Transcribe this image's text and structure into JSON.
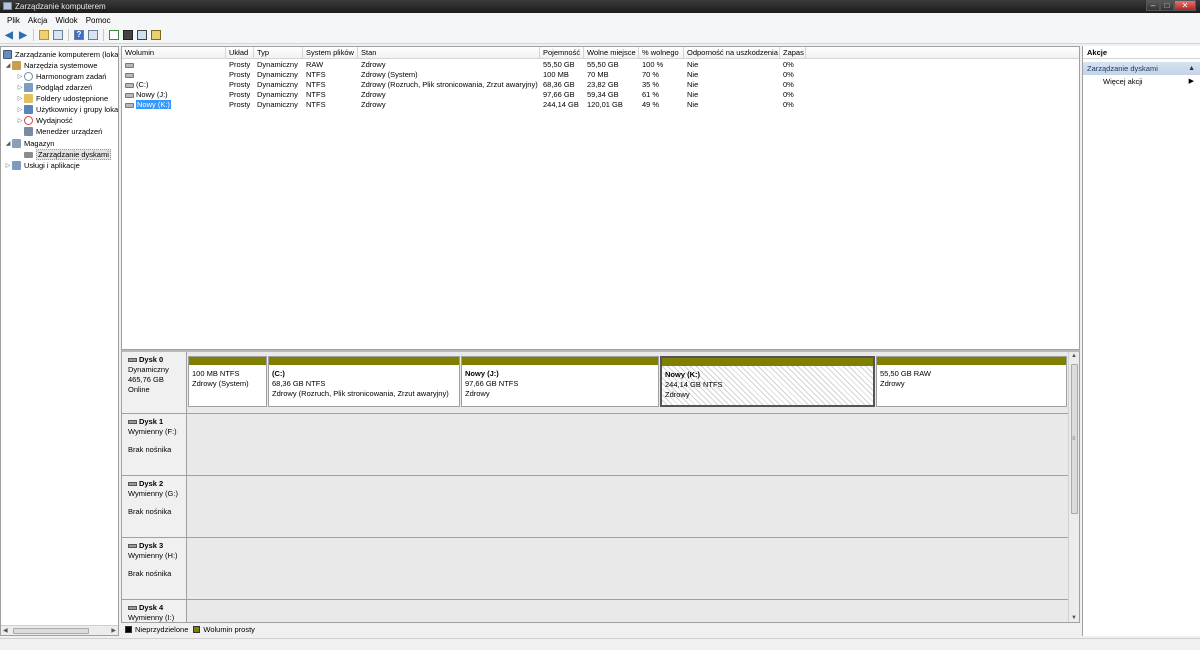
{
  "window": {
    "title": "Zarządzanie komputerem",
    "minimize": "–",
    "maximize": "□",
    "close": "✕"
  },
  "menu": [
    "Plik",
    "Akcja",
    "Widok",
    "Pomoc"
  ],
  "toolbar": {
    "back": "◀",
    "forward": "▶",
    "icons": [
      "up-folder-icon",
      "show-hide-tree-icon",
      "help-icon",
      "show-hide-action-pane-icon",
      "refresh-icon",
      "properties-icon",
      "search-icon",
      "settings-icon"
    ]
  },
  "tree": [
    {
      "label": "Zarządzanie komputerem (lokalne)",
      "icon": "computer-icon",
      "color": "#6b8cb8"
    },
    {
      "label": "Narzędzia systemowe",
      "icon": "tools-icon",
      "color": "#c8a04c",
      "expand": "◢"
    },
    {
      "label": "Harmonogram zadań",
      "icon": "clock-icon",
      "color": "#6f8fa8",
      "expand": "▷"
    },
    {
      "label": "Podgląd zdarzeń",
      "icon": "event-viewer-icon",
      "color": "#7e9bc0",
      "expand": "▷"
    },
    {
      "label": "Foldery udostępnione",
      "icon": "shared-folder-icon",
      "color": "#e0c060",
      "expand": "▷"
    },
    {
      "label": "Użytkownicy i grupy lokalne",
      "icon": "users-icon",
      "color": "#5b84b8",
      "expand": "▷"
    },
    {
      "label": "Wydajność",
      "icon": "performance-icon",
      "color": "#cc4444",
      "expand": "▷"
    },
    {
      "label": "Menedżer urządzeń",
      "icon": "device-manager-icon",
      "color": "#7a8aa0"
    },
    {
      "label": "Magazyn",
      "icon": "storage-icon",
      "color": "#8aa0b8",
      "expand": "◢"
    },
    {
      "label": "Zarządzanie dyskami",
      "icon": "disk-management-icon",
      "color": "#8c8c8c"
    },
    {
      "label": "Usługi i aplikacje",
      "icon": "services-icon",
      "color": "#7e9bc0",
      "expand": "▷"
    }
  ],
  "volumes": {
    "headers": [
      "Wolumin",
      "Układ",
      "Typ",
      "System plików",
      "Stan",
      "Pojemność",
      "Wolne miejsce",
      "% wolnego",
      "Odporność na uszkodzenia",
      "Zapas"
    ],
    "rows": [
      [
        "",
        "Prosty",
        "Dynamiczny",
        "RAW",
        "Zdrowy",
        "55,50 GB",
        "55,50 GB",
        "100 %",
        "Nie",
        "0%"
      ],
      [
        "",
        "Prosty",
        "Dynamiczny",
        "NTFS",
        "Zdrowy (System)",
        "100 MB",
        "70 MB",
        "70 %",
        "Nie",
        "0%"
      ],
      [
        "(C:)",
        "Prosty",
        "Dynamiczny",
        "NTFS",
        "Zdrowy (Rozruch, Plik stronicowania, Zrzut awaryjny)",
        "68,36 GB",
        "23,82 GB",
        "35 %",
        "Nie",
        "0%"
      ],
      [
        "Nowy (J:)",
        "Prosty",
        "Dynamiczny",
        "NTFS",
        "Zdrowy",
        "97,66 GB",
        "59,34 GB",
        "61 %",
        "Nie",
        "0%"
      ],
      [
        "Nowy (K:)",
        "Prosty",
        "Dynamiczny",
        "NTFS",
        "Zdrowy",
        "244,14 GB",
        "120,01 GB",
        "49 %",
        "Nie",
        "0%"
      ]
    ]
  },
  "disks": [
    {
      "name": "Dysk 0",
      "type": "Dynamiczny",
      "size": "465,76 GB",
      "status": "Online",
      "partitions": [
        {
          "name": "",
          "size": "100 MB NTFS",
          "status": "Zdrowy (System)"
        },
        {
          "name": "(C:)",
          "size": "68,36 GB NTFS",
          "status": "Zdrowy (Rozruch, Plik stronicowania, Zrzut awaryjny)"
        },
        {
          "name": "Nowy  (J:)",
          "size": "97,66 GB NTFS",
          "status": "Zdrowy"
        },
        {
          "name": "Nowy  (K:)",
          "size": "244,14 GB NTFS",
          "status": "Zdrowy"
        },
        {
          "name": "",
          "size": "55,50 GB RAW",
          "status": "Zdrowy"
        }
      ]
    },
    {
      "name": "Dysk 1",
      "type": "Wymienny (F:)",
      "media": "Brak nośnika"
    },
    {
      "name": "Dysk 2",
      "type": "Wymienny (G:)",
      "media": "Brak nośnika"
    },
    {
      "name": "Dysk 3",
      "type": "Wymienny (H:)",
      "media": "Brak nośnika"
    },
    {
      "name": "Dysk 4",
      "type": "Wymienny (I:)",
      "media": ""
    }
  ],
  "legend": [
    {
      "label": "Nieprzydzielone",
      "color": "#000000"
    },
    {
      "label": "Wolumin prosty",
      "color": "#808000"
    }
  ],
  "actions": {
    "header": "Akcje",
    "section": "Zarządzanie dyskami",
    "more": "Więcej akcji"
  }
}
